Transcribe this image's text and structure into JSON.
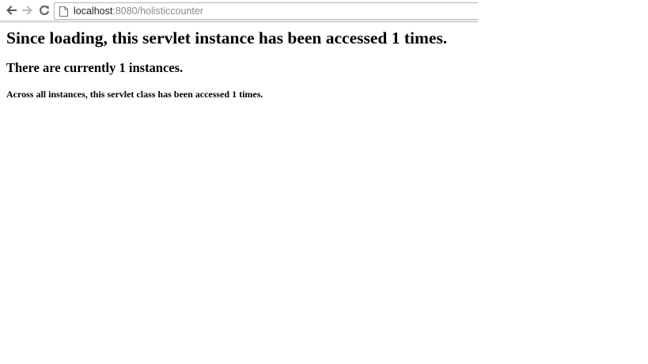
{
  "browser": {
    "url_host": "localhost",
    "url_rest": ":8080/holisticcounter",
    "icons": {
      "back": "arrow-left-icon",
      "forward": "arrow-right-icon",
      "reload": "reload-icon",
      "page": "page-icon"
    }
  },
  "page": {
    "heading1": "Since loading, this servlet instance has been accessed 1 times.",
    "heading2": "There are currently 1 instances.",
    "heading4": "Across all instances, this servlet class has been accessed 1 times."
  }
}
